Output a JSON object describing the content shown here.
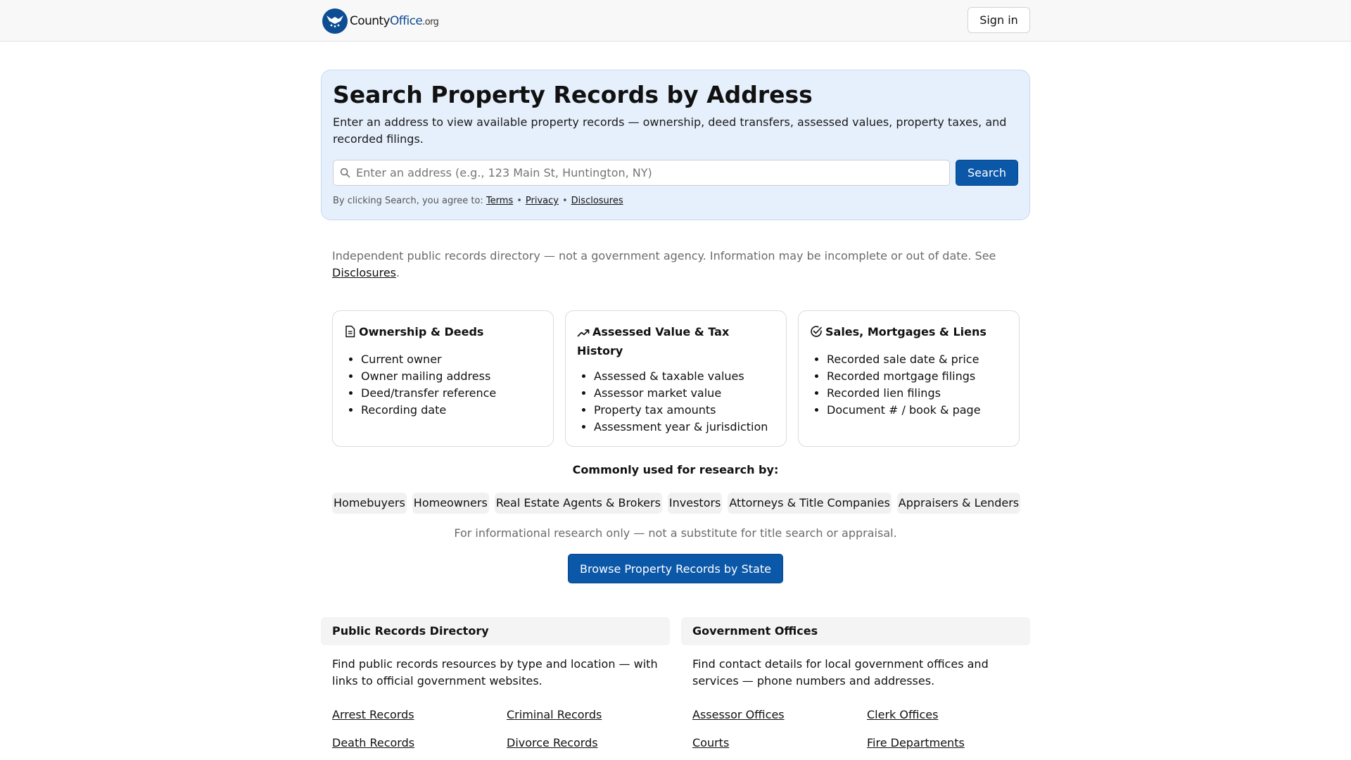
{
  "header": {
    "logo": {
      "prefix": "County",
      "brand": "Office",
      "tld": ".org"
    },
    "signin_label": "Sign in"
  },
  "hero": {
    "title": "Search Property Records by Address",
    "description": "Enter an address to view available property records — ownership, deed transfers, assessed values, property taxes, and recorded filings.",
    "search_placeholder": "Enter an address (e.g., 123 Main St, Huntington, NY)",
    "search_label": "Search",
    "agree_text": "By clicking Search, you agree to:",
    "agree_links": [
      "Terms",
      "Privacy",
      "Disclosures"
    ]
  },
  "notice": {
    "text": "Independent public records directory — not a government agency. Information may be incomplete or out of date. See",
    "link": "Disclosures",
    "end": "."
  },
  "cards": [
    {
      "title": "Ownership & Deeds",
      "icon": "document-icon",
      "items": [
        "Current owner",
        "Owner mailing address",
        "Deed/transfer reference",
        "Recording date"
      ]
    },
    {
      "title": "Assessed Value & Tax History",
      "icon": "trending-up-icon",
      "items": [
        "Assessed & taxable values",
        "Assessor market value",
        "Property tax amounts",
        "Assessment year & jurisdiction"
      ]
    },
    {
      "title": "Sales, Mortgages & Liens",
      "icon": "check-circle-icon",
      "items": [
        "Recorded sale date & price",
        "Recorded mortgage filings",
        "Recorded lien filings",
        "Document # / book & page"
      ]
    }
  ],
  "research": {
    "title": "Commonly used for research by:",
    "chips": [
      "Homebuyers",
      "Homeowners",
      "Real Estate Agents & Brokers",
      "Investors",
      "Attorneys & Title Companies",
      "Appraisers & Lenders"
    ],
    "note": "For informational research only — not a substitute for title search or appraisal.",
    "browse_label": "Browse Property Records by State"
  },
  "directory": {
    "title": "Public Records Directory",
    "description": "Find public records resources by type and location — with links to official government websites.",
    "links": [
      "Arrest Records",
      "Criminal Records",
      "Death Records",
      "Divorce Records"
    ]
  },
  "offices": {
    "title": "Government Offices",
    "description": "Find contact details for local government offices and services — phone numbers and addresses.",
    "links": [
      "Assessor Offices",
      "Clerk Offices",
      "Courts",
      "Fire Departments"
    ]
  },
  "colors": {
    "primary": "#0b57a8",
    "hero_bg": "#e6f0fc",
    "muted_text": "#6b6b6b"
  }
}
